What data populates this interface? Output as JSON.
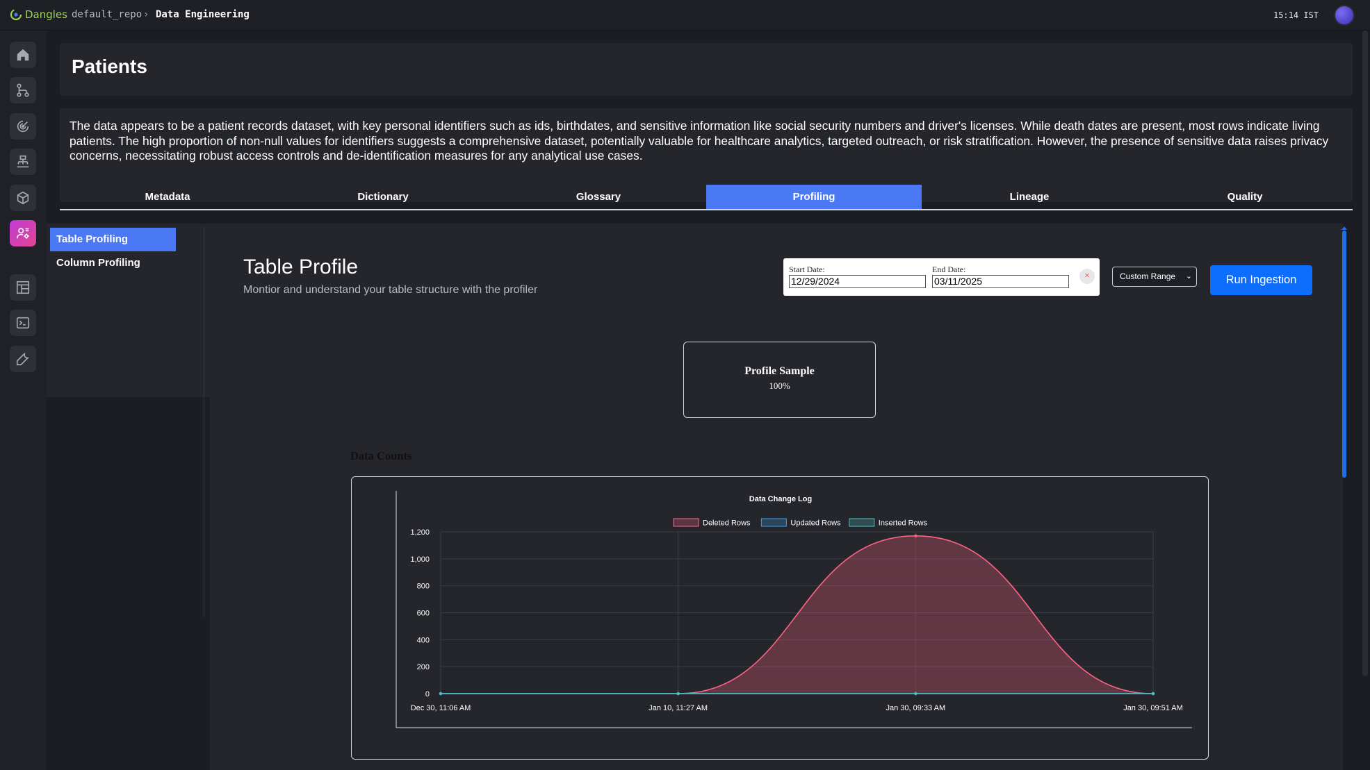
{
  "topbar": {
    "brand": "Dangles",
    "repo": "default_repo",
    "separator": "›",
    "current": "Data Engineering",
    "clock": "15:14 IST"
  },
  "rail": {
    "items": [
      {
        "icon": "home-icon"
      },
      {
        "icon": "hierarchy-icon"
      },
      {
        "icon": "radar-icon"
      },
      {
        "icon": "pipeline-icon"
      },
      {
        "icon": "cube-icon"
      },
      {
        "icon": "user-settings-icon",
        "active": true
      },
      {
        "icon": "layout-icon"
      },
      {
        "icon": "terminal-icon"
      },
      {
        "icon": "wrench-icon"
      }
    ]
  },
  "page": {
    "title": "Patients",
    "description": "The data appears to be a patient records dataset, with key personal identifiers such as ids, birthdates, and sensitive information like social security numbers and driver's licenses. While death dates are present, most rows indicate living patients. The high proportion of non-null values for identifiers suggests a comprehensive dataset, potentially valuable for healthcare analytics, targeted outreach, or risk stratification. However, the presence of sensitive data raises privacy concerns, necessitating robust access controls and de-identification measures for any analytical use cases."
  },
  "tabs": [
    "Metadata",
    "Dictionary",
    "Glossary",
    "Profiling",
    "Lineage",
    "Quality"
  ],
  "active_tab": "Profiling",
  "subnav": {
    "items": [
      "Table Profiling",
      "Column Profiling"
    ],
    "active": "Table Profiling"
  },
  "profile": {
    "title": "Table Profile",
    "subtitle": "Montior and understand your table structure with the profiler",
    "start_label": "Start Date:",
    "start_value": "12/29/2024",
    "end_label": "End Date:",
    "end_value": "03/11/2025",
    "clear_symbol": "×",
    "range_value": "Custom Range",
    "run_label": "Run Ingestion",
    "sample_title": "Profile Sample",
    "sample_value": "100%",
    "counts_title": "Data Counts"
  },
  "colors": {
    "accent": "#4b79f5",
    "run_button": "#0d6efd",
    "deleted": "#ff6384",
    "updated": "#36a2eb",
    "inserted": "#4bc0c0"
  },
  "chart_data": {
    "type": "line",
    "title": "Data Change Log",
    "categories": [
      "Dec 30, 11:06 AM",
      "Jan 10, 11:27 AM",
      "Jan 30, 09:33 AM",
      "Jan 30, 09:51 AM"
    ],
    "series": [
      {
        "name": "Deleted Rows",
        "values": [
          0,
          0,
          1170,
          0
        ],
        "color": "#ff6384",
        "fill": true
      },
      {
        "name": "Updated Rows",
        "values": [
          0,
          0,
          0,
          0
        ],
        "color": "#36a2eb"
      },
      {
        "name": "Inserted Rows",
        "values": [
          0,
          0,
          0,
          0
        ],
        "color": "#4bc0c0"
      }
    ],
    "yticks": [
      "0",
      "200",
      "400",
      "600",
      "800",
      "1,000",
      "1,200"
    ],
    "ylim": [
      0,
      1200
    ],
    "legend": "top",
    "grid": true
  }
}
